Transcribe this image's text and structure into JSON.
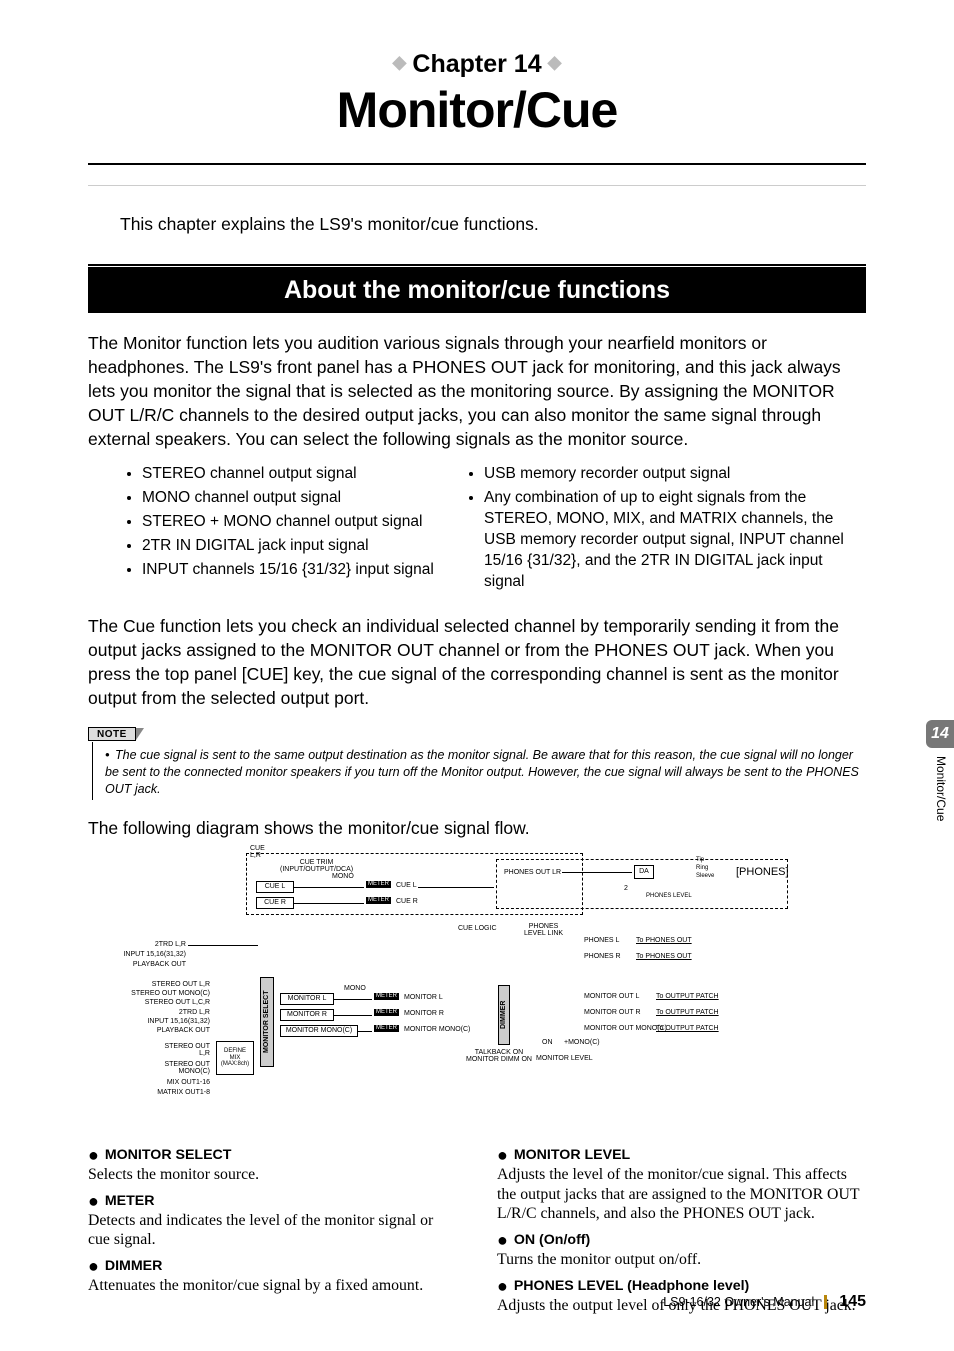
{
  "header": {
    "chapter_label": "Chapter 14",
    "title": "Monitor/Cue"
  },
  "intro": "This chapter explains the LS9's monitor/cue functions.",
  "section_title": "About the monitor/cue functions",
  "para1": "The Monitor function lets you audition various signals through your nearfield monitors or headphones. The LS9's front panel has a PHONES OUT jack for monitoring, and this jack always lets you monitor the signal that is selected as the monitoring source. By assigning the MONITOR OUT L/R/C channels to the desired output jacks, you can also monitor the same signal through external speakers. You can select the following signals as the monitor source.",
  "bullets_left": [
    "STEREO channel output signal",
    "MONO channel output signal",
    "STEREO + MONO channel output signal",
    "2TR IN DIGITAL jack input signal",
    "INPUT channels 15/16 {31/32} input signal"
  ],
  "bullets_right": [
    "USB memory recorder output signal",
    "Any combination of up to eight signals from the STEREO, MONO, MIX, and MATRIX channels, the USB memory recorder output signal, INPUT channel 15/16 {31/32}, and the 2TR IN DIGITAL jack input signal"
  ],
  "para2": "The Cue function lets you check an individual selected channel by temporarily sending it from the output jacks assigned to the MONITOR OUT channel or from the PHONES OUT jack. When you press the top panel [CUE] key, the cue signal of the corresponding channel is sent as the monitor output from the selected output port.",
  "note_label": "NOTE",
  "note_text": "The cue signal is sent to the same output destination as the monitor signal. Be aware that for this reason, the cue signal will no longer be sent to the connected monitor speakers if you turn off the Monitor output. However, the cue signal will always be sent to the PHONES OUT jack.",
  "diagram_caption": "The following diagram shows the monitor/cue signal flow.",
  "diagram": {
    "top_block": "CUE\nL,R",
    "cue_trim": "CUE TRIM\n(INPUT/OUTPUT/DCA)",
    "cue_l": "CUE L",
    "cue_r": "CUE R",
    "mono1": "MONO",
    "meter_cue_l": "METER",
    "meter_cue_r": "METER",
    "meter_cue_l_txt": "CUE L",
    "meter_cue_r_txt": "CUE R",
    "phones_out_lr": "PHONES OUT LR",
    "da": "DA",
    "phones": "[PHONES]",
    "tip": "Tip",
    "ring": "Ring",
    "sleeve": "Sleeve",
    "phones_level_small": "PHONES LEVEL",
    "cue_logic": "CUE LOGIC",
    "phones_level_link": "PHONES\nLEVEL LINK",
    "phones_l": "PHONES L",
    "phones_r": "PHONES R",
    "to_phones_out": "To PHONES OUT",
    "inputs_left_a": "2TRD L,R",
    "inputs_left_b": "INPUT 15,16(31,32)",
    "inputs_left_c": "PLAYBACK OUT",
    "inputs_mid_1": "STEREO OUT L,R",
    "inputs_mid_2": "STEREO OUT MONO(C)",
    "inputs_mid_3": "STEREO OUT L,C,R",
    "inputs_mid_4": "2TRD L,R",
    "inputs_mid_5": "INPUT 15,16(31,32)",
    "inputs_mid_6": "PLAYBACK OUT",
    "inputs_low_1": "STEREO OUT\nL,R",
    "inputs_low_2": "STEREO OUT\nMONO(C)",
    "inputs_low_3": "MIX OUT1-16",
    "inputs_low_4": "MATRIX OUT1-8",
    "define_mix": "DEFINE\nMIX\n(MAX:8ch)",
    "monitor_select_v": "MONITOR SELECT",
    "monitor_l": "MONITOR L",
    "monitor_r": "MONITOR R",
    "monitor_mono": "MONITOR MONO(C)",
    "mono2": "MONO",
    "meter_mon_l": "METER",
    "meter_mon_r": "METER",
    "meter_mon_m": "METER",
    "mon_l_txt": "MONITOR L",
    "mon_r_txt": "MONITOR R",
    "mon_m_txt": "MONITOR MONO(C)",
    "dimmer_v": "DIMMER",
    "talkback_dimm": "TALKBACK ON\nMONITOR DIMM ON",
    "monitor_level_small": "MONITOR LEVEL",
    "on": "ON",
    "add_mono": "+MONO(C)",
    "monitor_out_l": "MONITOR OUT L",
    "monitor_out_r": "MONITOR OUT R",
    "monitor_out_mono": "MONITOR OUT MONO(C)",
    "to_output_patch": "To OUTPUT PATCH",
    "two": "2"
  },
  "defs": {
    "monitor_select_h": "MONITOR SELECT",
    "monitor_select_b": "Selects the monitor source.",
    "meter_h": "METER",
    "meter_b": "Detects and indicates the level of the monitor signal or cue signal.",
    "dimmer_h": "DIMMER",
    "dimmer_b": "Attenuates the monitor/cue signal by a fixed amount.",
    "monitor_level_h": "MONITOR LEVEL",
    "monitor_level_b": "Adjusts the level of the monitor/cue signal. This affects the output jacks that are assigned to the MONITOR OUT L/R/C channels, and also the PHONES OUT jack.",
    "on_h": "ON (On/off)",
    "on_b": "Turns the monitor output on/off.",
    "phones_level_h": "PHONES LEVEL (Headphone level)",
    "phones_level_b": "Adjusts the output level of only the PHONES OUT jack."
  },
  "footer": {
    "manual": "LS9-16/32  Owner's Manual",
    "page": "145"
  },
  "tab": {
    "num": "14",
    "text": "Monitor/Cue"
  }
}
